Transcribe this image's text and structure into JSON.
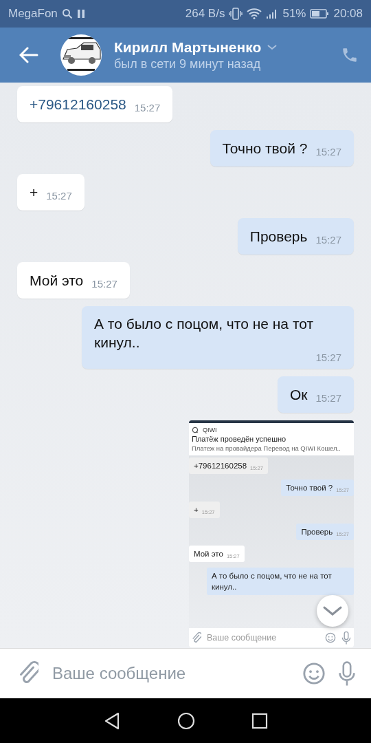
{
  "status_bar": {
    "carrier": "MegaFon",
    "speed": "264 B/s",
    "battery": "51%",
    "time": "20:08"
  },
  "header": {
    "name": "Кирилл Мартыненко",
    "status": "был в сети 9 минут назад"
  },
  "messages": [
    {
      "kind": "text",
      "outgoing": false,
      "text": "+79612160258",
      "time": "15:27",
      "link": true
    },
    {
      "kind": "text",
      "outgoing": true,
      "text": "Точно твой ?",
      "time": "15:27"
    },
    {
      "kind": "text",
      "outgoing": false,
      "text": "+",
      "time": "15:27"
    },
    {
      "kind": "text",
      "outgoing": true,
      "text": "Проверь",
      "time": "15:27"
    },
    {
      "kind": "text",
      "outgoing": false,
      "text": "Мой это",
      "time": "15:27"
    },
    {
      "kind": "text",
      "outgoing": true,
      "text": "А то было с поцом, что не на тот кинул..",
      "time": "15:27"
    },
    {
      "kind": "text",
      "outgoing": true,
      "text": "Ок",
      "time": "15:27"
    },
    {
      "kind": "screenshot",
      "outgoing": true,
      "notification": {
        "app": "QIWI",
        "title": "Платёж проведён успешно",
        "body": "Платеж на провайдера Перевод на QIWI Кошел.."
      },
      "messages": [
        {
          "outgoing": false,
          "text": "+79612160258",
          "time": "15:27"
        },
        {
          "outgoing": true,
          "text": "Точно твой ?",
          "time": "15:27"
        },
        {
          "outgoing": false,
          "text": "+",
          "time": "15:27"
        },
        {
          "outgoing": true,
          "text": "Проверь",
          "time": "15:27"
        },
        {
          "outgoing": false,
          "text": "Мой это",
          "time": "15:27"
        },
        {
          "outgoing": true,
          "text": "А то было с поцом, что не на тот кинул.."
        }
      ],
      "placeholder": "Ваше сообщение"
    }
  ],
  "composer": {
    "placeholder": "Ваше сообщение"
  }
}
